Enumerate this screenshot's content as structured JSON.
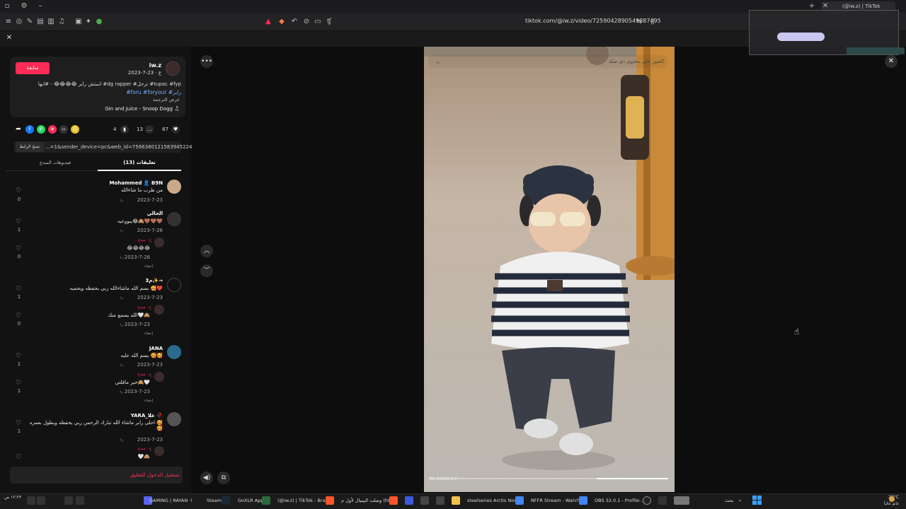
{
  "browser": {
    "tab_title": "(@iw.z) | TikTok",
    "url": "tiktok.com/@iw.z/video/7259042890549087495"
  },
  "post": {
    "follow_label": "متابعة",
    "author": "iw.z",
    "date": "2023-7-23 · ع",
    "caption_line1": "استش رابر 😂😂😂😂 - #ابها #dg rapper #ترحل #tupac #fyp",
    "caption_line2": "#foru #foryour #رابر",
    "translate": "عرض الترجمة",
    "music": "Gin and Juice - Snoop Dogg",
    "likes": "87",
    "comments": "13",
    "saves": "4",
    "copy_link_label": "نسخ الرابط",
    "link_url": "...=1&sender_device=pc&web_id=7566380121583945224"
  },
  "tabs": {
    "comments": "تعليقات (13)",
    "creator_videos": "فيديوهات المبدع"
  },
  "comments": [
    {
      "user": "Mohammed 👤 B9N",
      "text": "من طرب ما شاءالله",
      "date": "2023-7-23",
      "reply": "رد",
      "likes": "0"
    },
    {
      "user": "الحالي",
      "text": "يبووعيه😂🙈🤎🤎🤎",
      "date": "2023-7-26",
      "reply": "رد",
      "likes": "1"
    },
    {
      "user": "ع · مبدع",
      "text": "😂😂😂😂",
      "date": "2023-7-26",
      "reply": "رد",
      "likes": "0",
      "hide": "إخفاء"
    },
    {
      "user": "3م✨→",
      "text": "بسم الله ماشاءالله ربي يحفظه ويحميه 🥰❤️",
      "date": "2023-7-23",
      "reply": "رد",
      "likes": "1"
    },
    {
      "user": "ع · مبدع",
      "text": "الله يسمع منك🤍🙈",
      "date": "2023-7-23",
      "reply": "رد",
      "likes": "0",
      "hide": "إخفاء"
    },
    {
      "user": "JANA",
      "text": "بسم الله عليه 🥰🥰",
      "date": "2023-7-23",
      "reply": "رد",
      "likes": "1"
    },
    {
      "user": "ع · مبدع",
      "text": "خير ماقلتي🙈🤍",
      "date": "2023-7-23",
      "reply": "رد",
      "likes": "1",
      "hide": "إخفاء"
    },
    {
      "user": "YARA_غلا 🥀",
      "text": "احلى رابر ماشاء الله تبارك الرحمن ربي يحفظه ويطول بعمره 🥰🥰",
      "date": "2023-7-23",
      "reply": "رد",
      "likes": "1"
    },
    {
      "user": "ع · مبدع",
      "text": "🤍🙈",
      "date": "2023-7-23",
      "reply": "رد",
      "likes": "",
      "hide": ""
    }
  ],
  "login_cta": "تسجيل الدخول للتعليق",
  "video": {
    "search_placeholder": "العثور على محتوى ذي صلة",
    "time": "00:20/00:07"
  },
  "taskbar": {
    "items": [
      "GAMING | RAYAN ·!",
      "Steam",
      "GoXLR App",
      "(@iw.z) | TikTok - Brav",
      "وصلت البيتيال لأول م (ht)",
      "steelseries Arctis Nova",
      "NFFR Stream - Watch Li",
      "OBS 32.0.1 - Profile: بدون"
    ],
    "search": "بحث",
    "temp": "29°C",
    "weather": "غائم غالباً",
    "clock": "١٢:٢٣ ص"
  },
  "colors": {
    "accent": "#fe2c55",
    "link": "#7ab6ff",
    "panel": "#121212"
  }
}
